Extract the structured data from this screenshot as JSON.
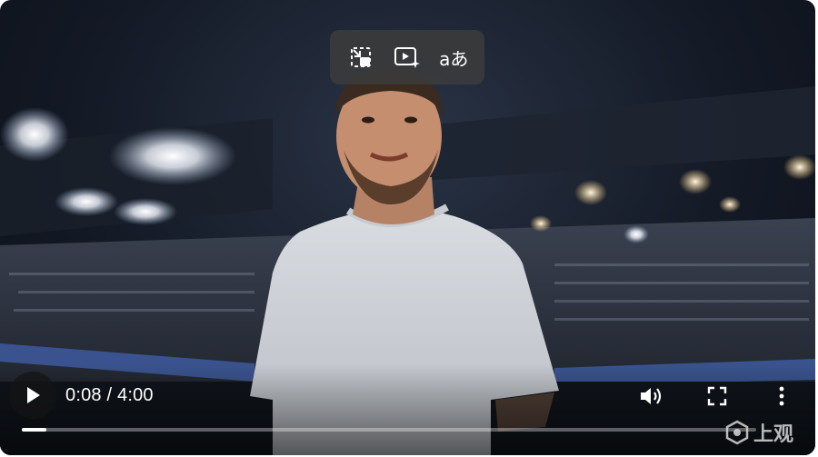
{
  "video": {
    "current_time": "0:08",
    "separator": "/",
    "duration": "4:00",
    "progress_fraction": 0.033
  },
  "overlay_buttons": [
    {
      "icon": "exit-pip-icon"
    },
    {
      "icon": "video-ai-icon"
    },
    {
      "icon": "translate-icon",
      "glyph": "aあ"
    }
  ],
  "controls": {
    "play_icon": "play-icon",
    "volume_icon": "volume-icon",
    "fullscreen_icon": "fullscreen-icon",
    "more_icon": "more-vertical-icon"
  },
  "watermark": {
    "text": "上观"
  }
}
